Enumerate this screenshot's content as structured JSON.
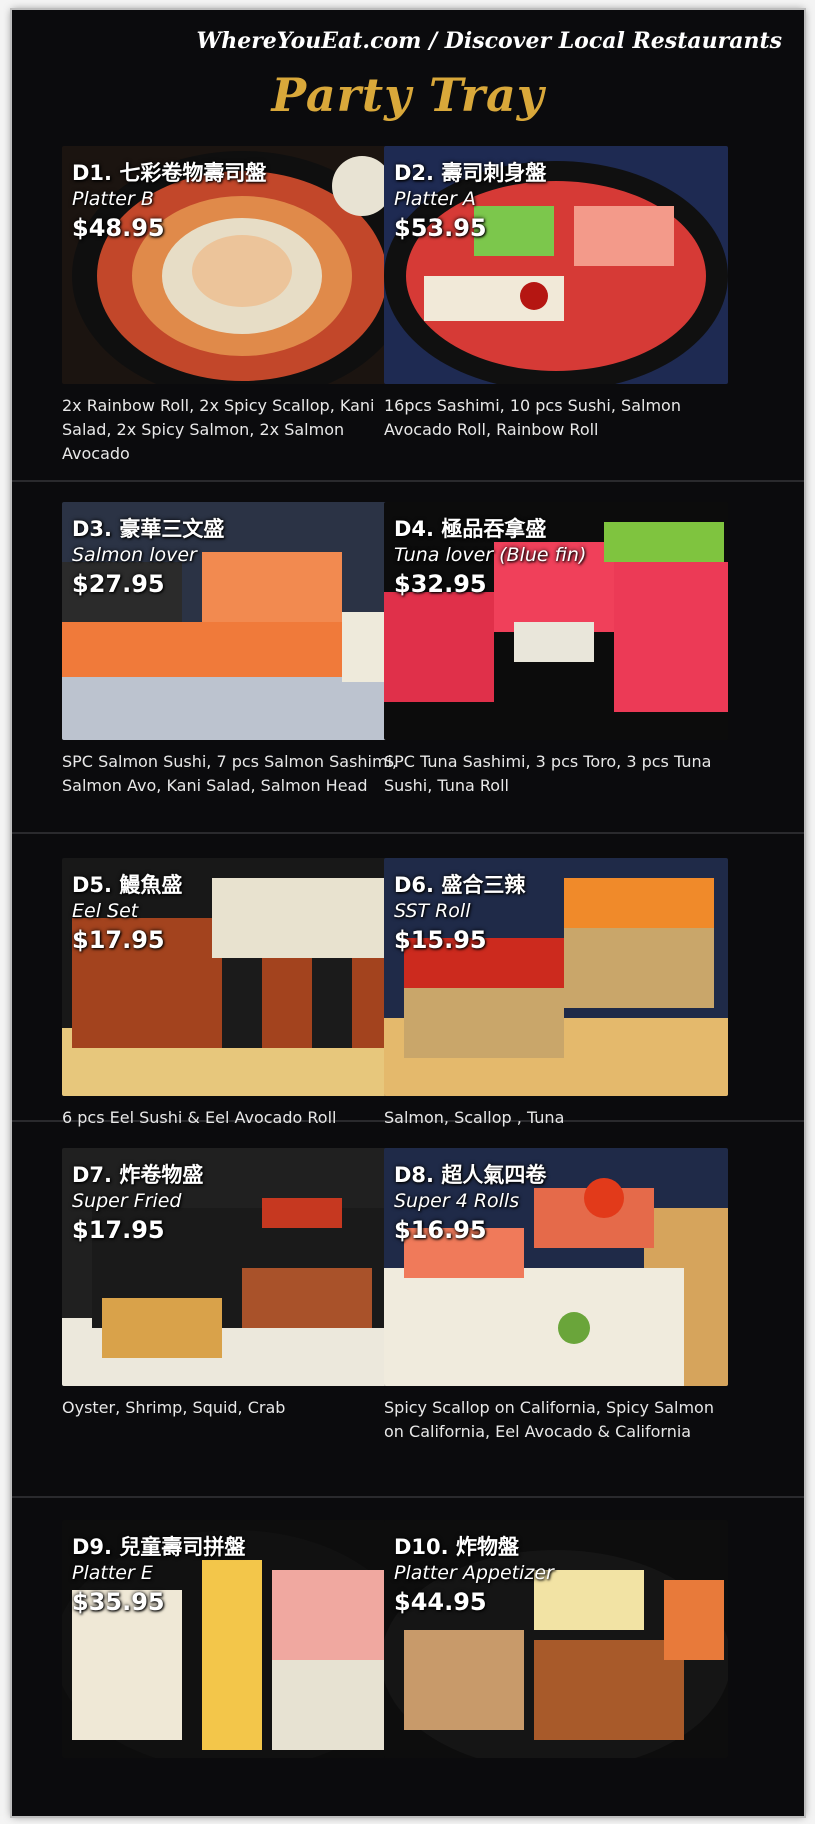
{
  "watermark": "WhereYouEat.com / Discover Local Restaurants",
  "section_title": "Party Tray",
  "items": [
    {
      "code": "D1. 七彩卷物壽司盤",
      "subtitle": "Platter B",
      "price": "$48.95",
      "description": "2x Rainbow Roll, 2x Spicy Scallop, Kani Salad, 2x Spicy Salmon, 2x Salmon Avocado"
    },
    {
      "code": "D2. 壽司刺身盤",
      "subtitle": "Platter A",
      "price": "$53.95",
      "description": "16pcs Sashimi, 10 pcs Sushi, Salmon Avocado Roll, Rainbow Roll"
    },
    {
      "code": "D3. 豪華三文盛",
      "subtitle": "Salmon lover",
      "price": "$27.95",
      "description": "SPC Salmon Sushi, 7 pcs Salmon Sashimi, Salmon Avo, Kani Salad, Salmon Head"
    },
    {
      "code": "D4. 極品吞拿盛",
      "subtitle": "Tuna lover (Blue fin)",
      "price": "$32.95",
      "description": "SPC Tuna Sashimi, 3 pcs Toro, 3 pcs Tuna Sushi, Tuna Roll"
    },
    {
      "code": "D5. 鰻魚盛",
      "subtitle": "Eel Set",
      "price": "$17.95",
      "description": "6 pcs Eel Sushi & Eel Avocado Roll"
    },
    {
      "code": "D6. 盛合三辣",
      "subtitle": "SST Roll",
      "price": "$15.95",
      "description": "Salmon, Scallop , Tuna"
    },
    {
      "code": "D7. 炸卷物盛",
      "subtitle": "Super Fried",
      "price": "$17.95",
      "description": "Oyster, Shrimp, Squid, Crab"
    },
    {
      "code": "D8. 超人氣四卷",
      "subtitle": "Super 4 Rolls",
      "price": "$16.95",
      "description": "Spicy Scallop on California, Spicy Salmon on California, Eel Avocado & California"
    },
    {
      "code": "D9. 兒童壽司拼盤",
      "subtitle": "Platter E",
      "price": "$35.95",
      "description": ""
    },
    {
      "code": "D10. 炸物盤",
      "subtitle": "Platter Appetizer",
      "price": "$44.95",
      "description": ""
    }
  ]
}
